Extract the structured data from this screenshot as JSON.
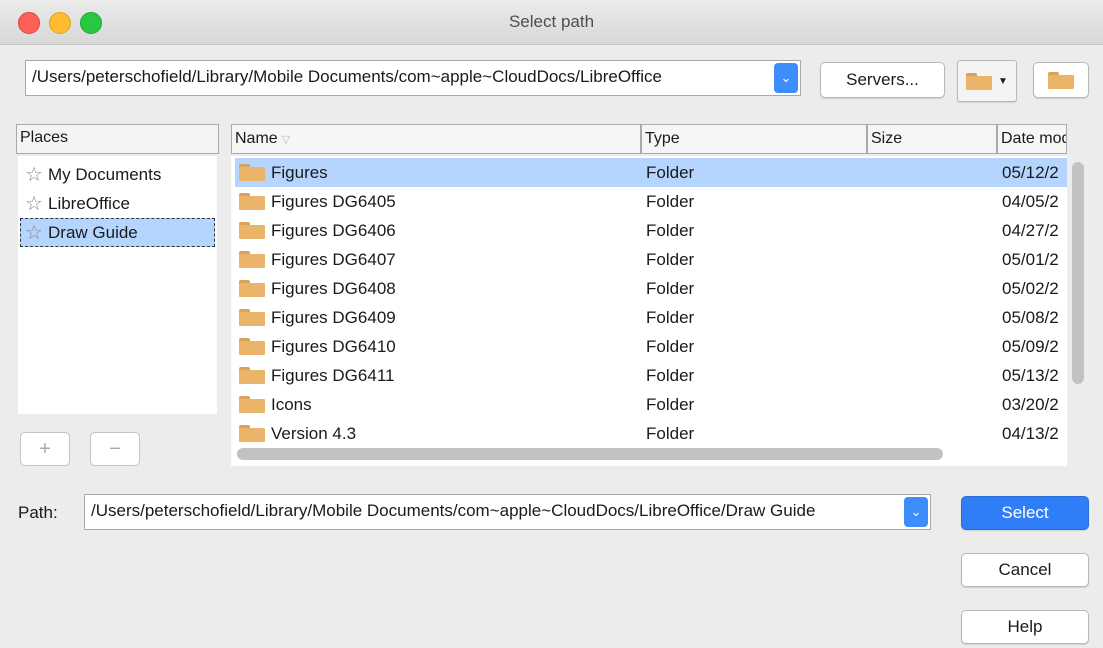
{
  "window": {
    "title": "Select path"
  },
  "toolbar": {
    "current_path": "/Users/peterschofield/Library/Mobile Documents/com~apple~CloudDocs/LibreOffice",
    "servers_label": "Servers..."
  },
  "places": {
    "header": "Places",
    "items": [
      {
        "label": "My Documents"
      },
      {
        "label": "LibreOffice"
      },
      {
        "label": "Draw Guide"
      }
    ],
    "add_label": "+",
    "remove_label": "−"
  },
  "files": {
    "columns": {
      "name": "Name",
      "type": "Type",
      "size": "Size",
      "date": "Date modi"
    },
    "rows": [
      {
        "name": "Figures",
        "type": "Folder",
        "size": "",
        "date": "05/12/2"
      },
      {
        "name": "Figures DG6405",
        "type": "Folder",
        "size": "",
        "date": "04/05/2"
      },
      {
        "name": "Figures DG6406",
        "type": "Folder",
        "size": "",
        "date": "04/27/2"
      },
      {
        "name": "Figures DG6407",
        "type": "Folder",
        "size": "",
        "date": "05/01/2"
      },
      {
        "name": "Figures DG6408",
        "type": "Folder",
        "size": "",
        "date": "05/02/2"
      },
      {
        "name": "Figures DG6409",
        "type": "Folder",
        "size": "",
        "date": "05/08/2"
      },
      {
        "name": "Figures DG6410",
        "type": "Folder",
        "size": "",
        "date": "05/09/2"
      },
      {
        "name": "Figures DG6411",
        "type": "Folder",
        "size": "",
        "date": "05/13/2"
      },
      {
        "name": "Icons",
        "type": "Folder",
        "size": "",
        "date": "03/20/2"
      },
      {
        "name": "Version 4.3",
        "type": "Folder",
        "size": "",
        "date": "04/13/2"
      }
    ]
  },
  "path": {
    "label": "Path:",
    "value": "/Users/peterschofield/Library/Mobile Documents/com~apple~CloudDocs/LibreOffice/Draw Guide"
  },
  "buttons": {
    "select": "Select",
    "cancel": "Cancel",
    "help": "Help"
  },
  "colors": {
    "accent": "#2f7ef7",
    "selection": "#b5d5ff",
    "folder": "#eab56b"
  }
}
